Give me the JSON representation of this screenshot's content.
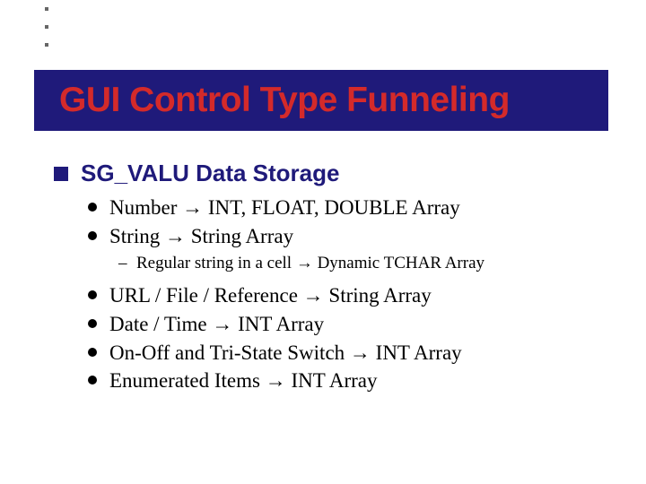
{
  "title": "GUI Control Type Funneling",
  "heading": "SG_VALU Data Storage",
  "arrow": "→",
  "bullets_a": [
    {
      "left": "Number",
      "right": "INT, FLOAT, DOUBLE Array"
    },
    {
      "left": "String",
      "right": "String Array"
    }
  ],
  "sub_a": {
    "left": "Regular string in a cell",
    "right": "Dynamic TCHAR Array"
  },
  "bullets_b": [
    {
      "left": "URL / File / Reference",
      "right": "String Array"
    },
    {
      "left": "Date / Time",
      "right": "INT Array"
    },
    {
      "left": "On-Off and Tri-State Switch",
      "right": "INT Array"
    },
    {
      "left": "Enumerated Items",
      "right": "INT Array"
    }
  ]
}
